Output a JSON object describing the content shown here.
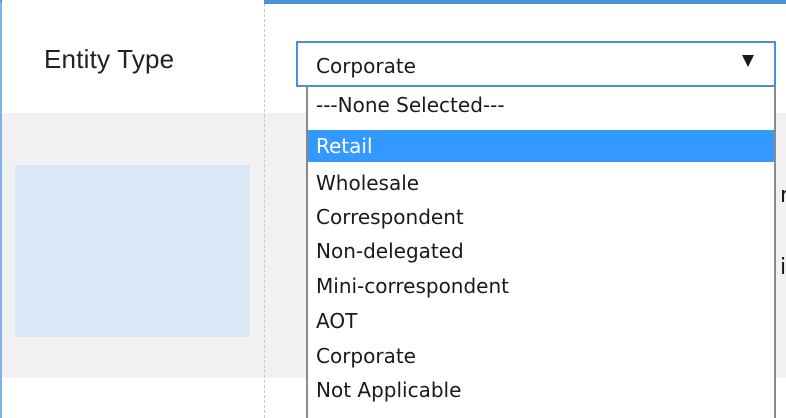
{
  "form": {
    "entity_type_label": "Entity Type"
  },
  "select": {
    "value": "Corporate"
  },
  "dropdown": {
    "options": [
      "---None Selected---",
      "Retail",
      "Wholesale",
      "Correspondent",
      "Non-delegated",
      "Mini-correspondent",
      "AOT",
      "Corporate",
      "Not Applicable"
    ],
    "highlighted_option": "Retail"
  },
  "peek": {
    "char_1": "r",
    "char_2": "i"
  },
  "colors": {
    "accent": "#4a90d9",
    "highlight": "#3399ff",
    "panel_blue": "#d9e8f6",
    "panel_gray": "#f1f1f1"
  },
  "icons": {
    "select_arrow": "triangle-down-icon"
  }
}
